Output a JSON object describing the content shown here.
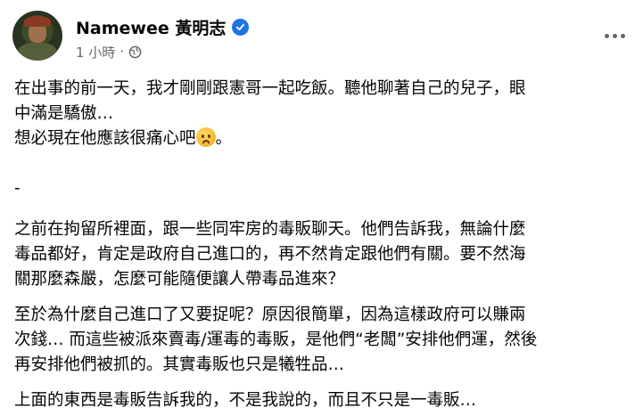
{
  "post": {
    "author": "Namewee 黃明志",
    "timestamp": "1 小時",
    "separator": "·",
    "icons": {
      "verified": "verified-badge-icon",
      "audience": "globe-icon",
      "menu": "more-options-icon",
      "emoji": "frowning-face-emoji"
    },
    "colors": {
      "verified": "#1b74e4",
      "meta": "#65676b",
      "text": "#050505"
    },
    "lines": [
      "在出事的前一天，我才剛剛跟憲哥一起吃飯。聽他聊著自己的兒子，眼",
      "中滿是驕傲…",
      "想必現在他應該很痛心吧",
      "。",
      "-",
      "之前在拘留所裡面，跟一些同牢房的毒販聊天。他們告訴我，無論什麼",
      "毒品都好，肯定是政府自己進口的，再不然肯定跟他們有關。要不然海",
      "關那麼森嚴，怎麼可能隨便讓人帶毒品進來？",
      "至於為什麼自己進口了又要捉呢？原因很簡單，因為這樣政府可以賺兩",
      "次錢… 而這些被派來賣毒/運毒的毒販，是他們“老闆”安排他們運，然後",
      "再安排他們被抓的。其實毒販也只是犧牲品…",
      "上面的東西是毒販告訴我的，不是我說的，而且不只是一毒販…"
    ]
  }
}
